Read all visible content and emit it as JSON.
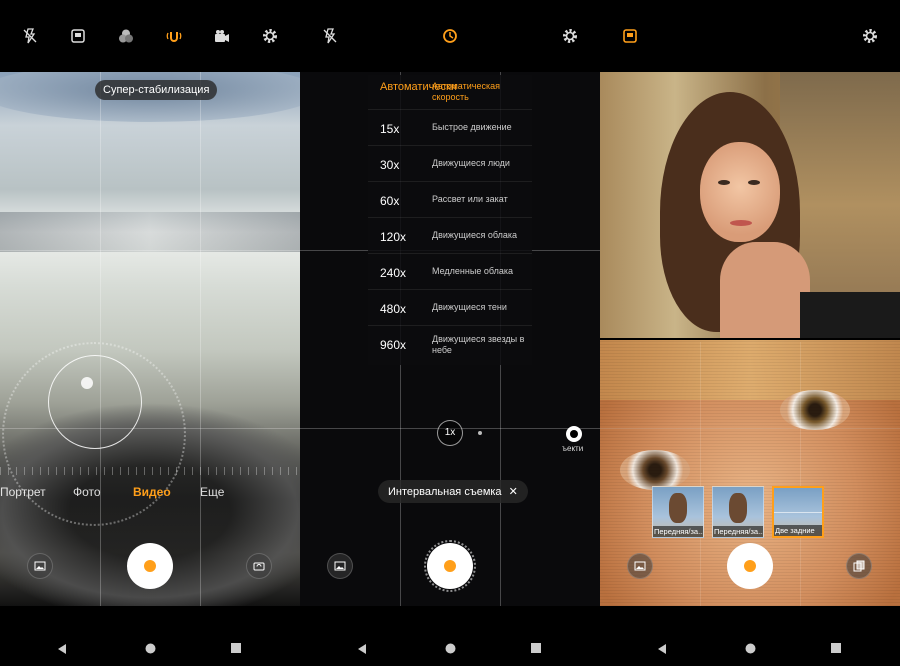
{
  "colors": {
    "accent": "#ff9f1a",
    "background": "#000000"
  },
  "panel1": {
    "top_icons": [
      "flash-off-icon",
      "aspect-ratio-icon",
      "filter-icon",
      "stabilization-icon",
      "video-camera-icon",
      "settings-icon"
    ],
    "stabilization_tooltip": "Супер-стабилизация",
    "modes": [
      "Портрет",
      "Фото",
      "Видео",
      "Еще"
    ],
    "active_mode": "Видео"
  },
  "panel2": {
    "top_icons": [
      "flash-off-icon",
      "timelapse-speed-icon",
      "settings-icon"
    ],
    "speed_list": [
      {
        "value": "Автоматически",
        "desc": "Автоматическая скорость",
        "active": true
      },
      {
        "value": "15x",
        "desc": "Быстрое движение"
      },
      {
        "value": "30x",
        "desc": "Движущиеся люди"
      },
      {
        "value": "60x",
        "desc": "Рассвет или закат"
      },
      {
        "value": "120x",
        "desc": "Движущиеся облака"
      },
      {
        "value": "240x",
        "desc": "Медленные облака"
      },
      {
        "value": "480x",
        "desc": "Движущиеся тени"
      },
      {
        "value": "960x",
        "desc": "Движущиеся звезды в небе"
      }
    ],
    "zoom": "1x",
    "lens_label": "ъекти",
    "mode_chip": "Интервальная съемка"
  },
  "panel3": {
    "top_icons": [
      "dual-view-icon",
      "settings-icon"
    ],
    "layouts": [
      {
        "label": "Передняя/за...",
        "selected": false
      },
      {
        "label": "Передняя/за...",
        "selected": false
      },
      {
        "label": "Две задние",
        "selected": true
      }
    ]
  },
  "navbar": {
    "buttons": [
      "back-icon",
      "home-icon",
      "recents-icon"
    ]
  }
}
